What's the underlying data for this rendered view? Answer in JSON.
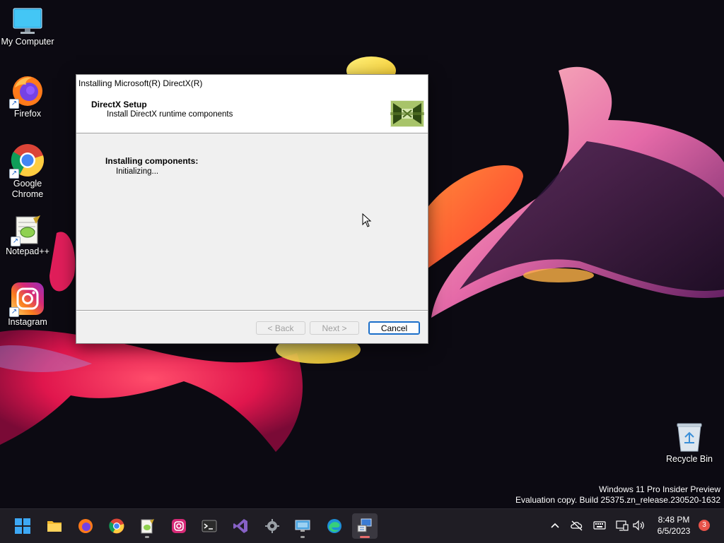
{
  "desktop": {
    "icons": [
      {
        "label_line1": "My Computer",
        "label_line2": "",
        "icon": "monitor-icon"
      },
      {
        "label_line1": "Firefox",
        "label_line2": "",
        "icon": "firefox-icon"
      },
      {
        "label_line1": "Google",
        "label_line2": "Chrome",
        "icon": "chrome-icon"
      },
      {
        "label_line1": "Notepad++",
        "label_line2": "",
        "icon": "notepad-plus-plus-icon"
      },
      {
        "label_line1": "Instagram",
        "label_line2": "",
        "icon": "instagram-icon"
      },
      {
        "label_line1": "Recycle Bin",
        "label_line2": "",
        "icon": "recycle-bin-icon"
      }
    ]
  },
  "dialog": {
    "title": "Installing Microsoft(R) DirectX(R)",
    "header_title": "DirectX Setup",
    "header_subtitle": "Install DirectX runtime components",
    "status_title": "Installing components:",
    "status_detail": "Initializing...",
    "buttons": {
      "back": "< Back",
      "next": "Next >",
      "cancel": "Cancel"
    }
  },
  "watermark": {
    "line1": "Windows 11 Pro Insider Preview",
    "line2": "Evaluation copy. Build 25375.zn_release.230520-1632"
  },
  "taskbar": {
    "items": [
      "start-icon",
      "file-explorer-icon",
      "firefox-icon",
      "chrome-icon",
      "notepad-plus-plus-icon",
      "instagram-icon",
      "terminal-icon",
      "visual-studio-icon",
      "settings-icon",
      "remote-desktop-icon",
      "edge-icon",
      "directx-setup-icon"
    ],
    "clock": {
      "time": "8:48 PM",
      "date": "6/5/2023"
    },
    "notification_count": "3"
  },
  "colors": {
    "accent": "#1a6ec9",
    "taskbar": "#1f1d24",
    "dialog_bg": "#f0f0f0",
    "badge": "#e8534a"
  }
}
